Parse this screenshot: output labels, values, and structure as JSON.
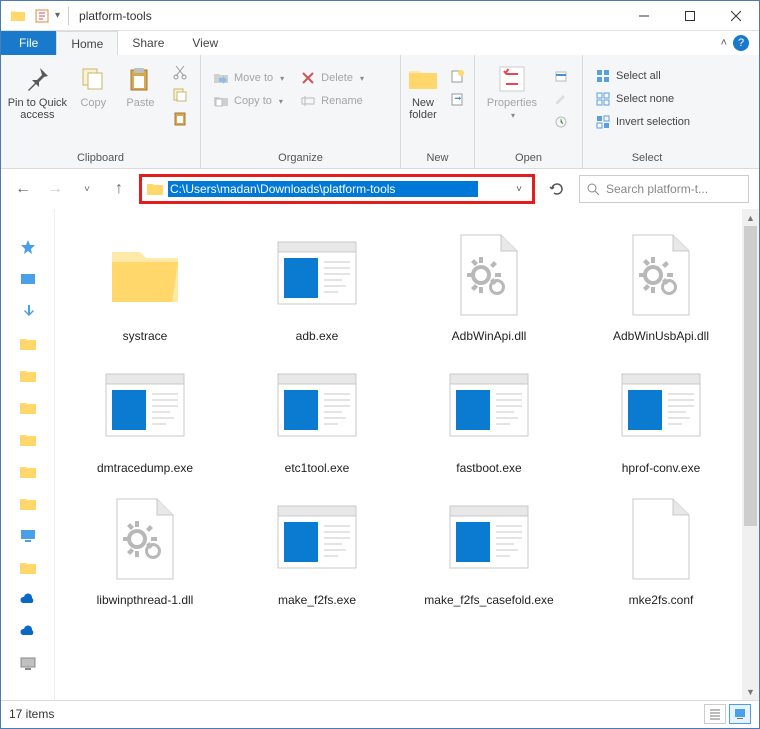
{
  "title": "platform-tools",
  "tabs": {
    "file": "File",
    "home": "Home",
    "share": "Share",
    "view": "View"
  },
  "ribbon": {
    "clipboard": {
      "label": "Clipboard",
      "pin": "Pin to Quick access",
      "copy": "Copy",
      "paste": "Paste"
    },
    "organize": {
      "label": "Organize",
      "moveto": "Move to",
      "copyto": "Copy to",
      "delete": "Delete",
      "rename": "Rename"
    },
    "new": {
      "label": "New",
      "newfolder": "New folder"
    },
    "open": {
      "label": "Open",
      "properties": "Properties"
    },
    "select": {
      "label": "Select",
      "all": "Select all",
      "none": "Select none",
      "invert": "Invert selection"
    }
  },
  "address": {
    "path": "C:\\Users\\madan\\Downloads\\platform-tools",
    "search_placeholder": "Search platform-t..."
  },
  "files": [
    {
      "name": "systrace",
      "type": "folder"
    },
    {
      "name": "adb.exe",
      "type": "exe"
    },
    {
      "name": "AdbWinApi.dll",
      "type": "dll"
    },
    {
      "name": "AdbWinUsbApi.dll",
      "type": "dll"
    },
    {
      "name": "dmtracedump.exe",
      "type": "exe"
    },
    {
      "name": "etc1tool.exe",
      "type": "exe"
    },
    {
      "name": "fastboot.exe",
      "type": "exe"
    },
    {
      "name": "hprof-conv.exe",
      "type": "exe"
    },
    {
      "name": "libwinpthread-1.dll",
      "type": "dll"
    },
    {
      "name": "make_f2fs.exe",
      "type": "exe"
    },
    {
      "name": "make_f2fs_casefold.exe",
      "type": "exe"
    },
    {
      "name": "mke2fs.conf",
      "type": "blank"
    }
  ],
  "status": {
    "count": "17 items"
  }
}
